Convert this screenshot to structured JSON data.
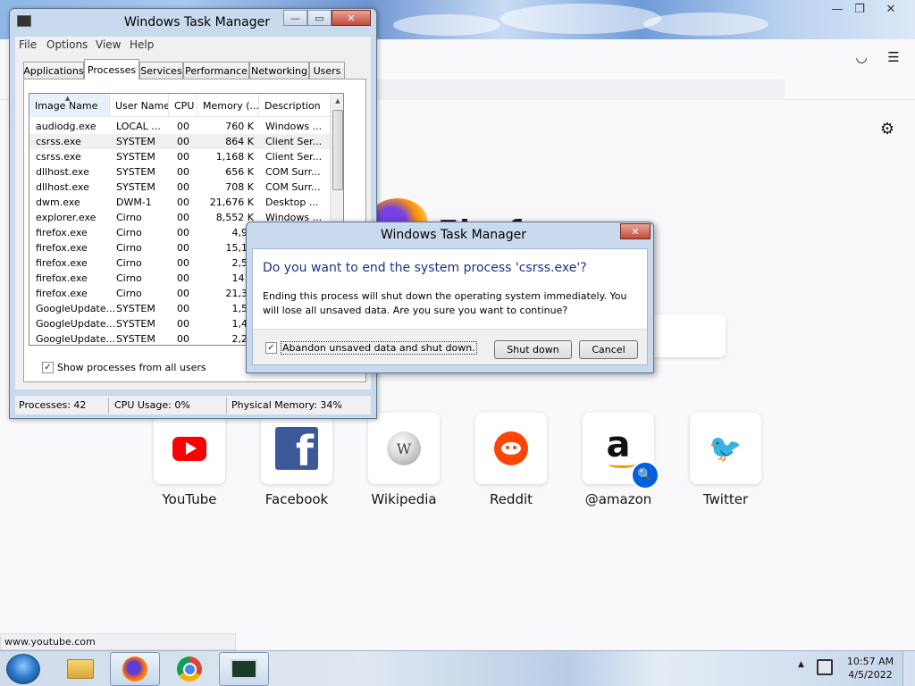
{
  "firefox": {
    "wordmark": "Firefox",
    "status_url": "www.youtube.com",
    "tiles": [
      {
        "label": "YouTube"
      },
      {
        "label": "Facebook"
      },
      {
        "label": "Wikipedia"
      },
      {
        "label": "Reddit"
      },
      {
        "label": "@amazon"
      },
      {
        "label": "Twitter"
      }
    ]
  },
  "taskmgr": {
    "title": "Windows Task Manager",
    "menu": [
      "File",
      "Options",
      "View",
      "Help"
    ],
    "tabs": [
      "Applications",
      "Processes",
      "Services",
      "Performance",
      "Networking",
      "Users"
    ],
    "active_tab": "Processes",
    "columns": [
      "Image Name",
      "User Name",
      "CPU",
      "Memory (...",
      "Description"
    ],
    "rows": [
      [
        "audiodg.exe",
        "LOCAL ...",
        "00",
        "760 K",
        "Windows ..."
      ],
      [
        "csrss.exe",
        "SYSTEM",
        "00",
        "864 K",
        "Client Ser..."
      ],
      [
        "csrss.exe",
        "SYSTEM",
        "00",
        "1,168 K",
        "Client Ser..."
      ],
      [
        "dllhost.exe",
        "SYSTEM",
        "00",
        "656 K",
        "COM Surr..."
      ],
      [
        "dllhost.exe",
        "SYSTEM",
        "00",
        "708 K",
        "COM Surr..."
      ],
      [
        "dwm.exe",
        "DWM-1",
        "00",
        "21,676 K",
        "Desktop ..."
      ],
      [
        "explorer.exe",
        "Cirno",
        "00",
        "8,552 K",
        "Windows ..."
      ],
      [
        "firefox.exe",
        "Cirno",
        "00",
        "4,99",
        ""
      ],
      [
        "firefox.exe",
        "Cirno",
        "00",
        "15,10",
        ""
      ],
      [
        "firefox.exe",
        "Cirno",
        "00",
        "2,52",
        ""
      ],
      [
        "firefox.exe",
        "Cirno",
        "00",
        "141,",
        ""
      ],
      [
        "firefox.exe",
        "Cirno",
        "00",
        "21,37",
        ""
      ],
      [
        "GoogleUpdate...",
        "SYSTEM",
        "00",
        "1,53",
        ""
      ],
      [
        "GoogleUpdate...",
        "SYSTEM",
        "00",
        "1,40",
        ""
      ],
      [
        "GoogleUpdate...",
        "SYSTEM",
        "00",
        "2,26",
        ""
      ]
    ],
    "show_all_label": "Show processes from all users",
    "show_all_checked": true,
    "status": {
      "processes": "Processes: 42",
      "cpu": "CPU Usage: 0%",
      "memory": "Physical Memory: 34%"
    }
  },
  "dialog": {
    "title": "Windows Task Manager",
    "question": "Do you want to end the system process 'csrss.exe'?",
    "message": "Ending this process will shut down the operating system immediately.  You will lose all unsaved data.  Are you sure you want to continue?",
    "checkbox_label": "Abandon unsaved data and shut down.",
    "checkbox_checked": true,
    "shutdown_label": "Shut down",
    "cancel_label": "Cancel"
  },
  "taskbar": {
    "time": "10:57 AM",
    "date": "4/5/2022"
  },
  "icons": {
    "close": "✕",
    "minimize": "▭",
    "maximize": "❐",
    "check": "✓",
    "gear": "⚙",
    "search": "🔍",
    "twitter": "🐦",
    "wiki": "W",
    "fb": "f",
    "amazon": "a",
    "menu": "☰",
    "pocket": "◡"
  }
}
